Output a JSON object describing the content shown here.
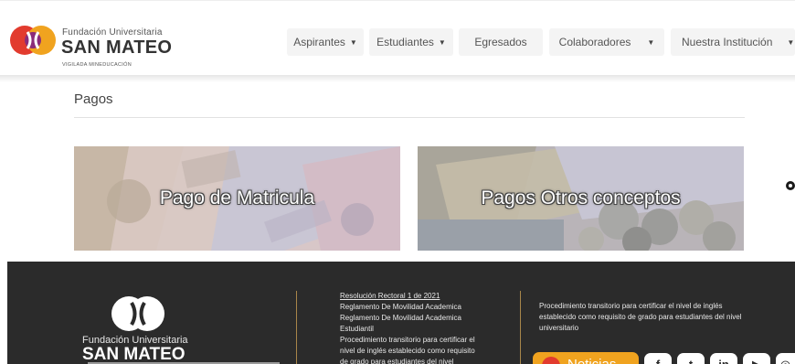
{
  "brand": {
    "name_small": "Fundación Universitaria",
    "name_big": "SAN MATEO",
    "tagline": "VIGILADA MINEDUCACIÓN"
  },
  "nav": {
    "items": [
      {
        "label": "Aspirantes",
        "has_caret": true
      },
      {
        "label": "Estudiantes",
        "has_caret": true
      },
      {
        "label": "Egresados",
        "has_caret": false
      },
      {
        "label": "Colaboradores",
        "has_caret": true
      },
      {
        "label": "Nuestra Institución",
        "has_caret": true
      }
    ],
    "caret_glyph": "▼"
  },
  "page": {
    "title": "Pagos",
    "cards": [
      {
        "label": "Pago de Matricula"
      },
      {
        "label": "Pagos Otros conceptos"
      }
    ]
  },
  "footer": {
    "brand_small": "Fundación Universitaria",
    "brand_big": "SAN MATEO",
    "links": [
      "Resolución Rectoral 1 de 2021",
      "Reglamento De Movilidad Academica",
      "Reglamento De Movilidad Academica",
      "Estudiantil",
      "Procedimiento transitorio para certificar el",
      "nivel de inglés establecido como requisito",
      "de grado para estudiantes del nivel"
    ],
    "procedure_text": "Procedimiento transitorio para certificar el nivel de inglés establecido como requisito de grado para estudiantes del nivel universitario",
    "noticias_label": "Noticias",
    "social": [
      {
        "icon": "facebook-icon",
        "glyph": "f"
      },
      {
        "icon": "twitter-icon",
        "glyph": "t"
      },
      {
        "icon": "linkedin-icon",
        "glyph": "in"
      },
      {
        "icon": "youtube-icon",
        "glyph": "▶"
      },
      {
        "icon": "instagram-icon",
        "glyph": "◎"
      }
    ]
  },
  "colors": {
    "accent_orange": "#f0a31f",
    "footer_bg": "#2b2b2b",
    "divider_gold": "#a8864a",
    "logo_red": "#e23b2e"
  }
}
